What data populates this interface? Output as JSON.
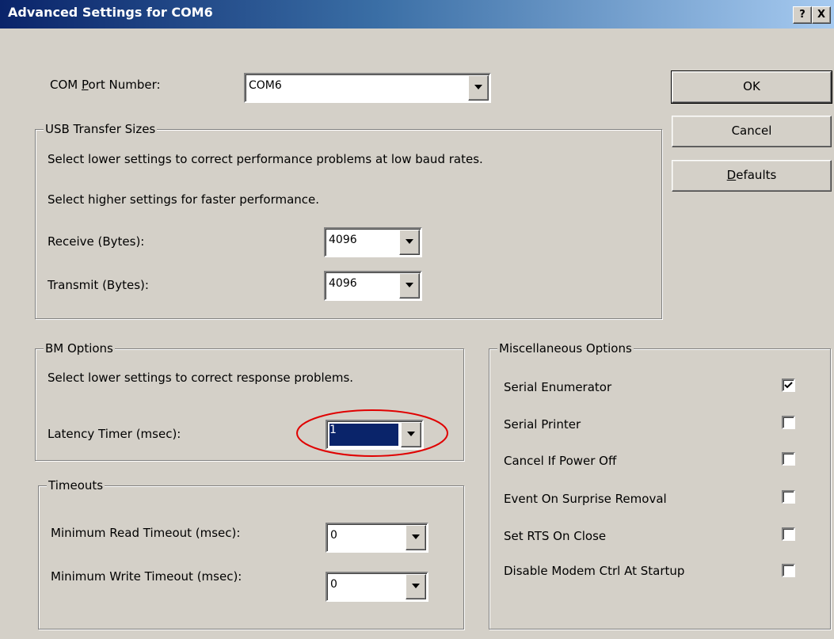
{
  "window": {
    "title": "Advanced Settings for COM6",
    "help_label": "?",
    "close_label": "X"
  },
  "com_port": {
    "label_pre": "COM ",
    "label_accel": "P",
    "label_post": "ort Number:",
    "value": "COM6"
  },
  "buttons": {
    "ok": "OK",
    "cancel": "Cancel",
    "defaults_accel": "D",
    "defaults_rest": "efaults"
  },
  "usb": {
    "title": "USB Transfer Sizes",
    "hint_low": "Select lower settings to correct performance problems at low baud rates.",
    "hint_high": "Select higher settings for faster performance.",
    "receive_label": "Receive (Bytes):",
    "receive_value": "4096",
    "transmit_label": "Transmit (Bytes):",
    "transmit_value": "4096"
  },
  "bm": {
    "title": "BM Options",
    "hint": "Select lower settings to correct response problems.",
    "latency_label": "Latency Timer (msec):",
    "latency_value": "1"
  },
  "timeouts": {
    "title": "Timeouts",
    "read_label": "Minimum Read Timeout (msec):",
    "read_value": "0",
    "write_label": "Minimum Write Timeout (msec):",
    "write_value": "0"
  },
  "misc": {
    "title": "Miscellaneous Options",
    "options": [
      {
        "label": "Serial Enumerator",
        "checked": true
      },
      {
        "label": "Serial Printer",
        "checked": false
      },
      {
        "label": "Cancel If Power Off",
        "checked": false
      },
      {
        "label": "Event On Surprise Removal",
        "checked": false
      },
      {
        "label": "Set RTS On Close",
        "checked": false
      },
      {
        "label": "Disable Modem Ctrl At Startup",
        "checked": false
      }
    ]
  },
  "colors": {
    "titlebar_start": "#0a246a",
    "titlebar_end": "#a6caf0",
    "dialog_face": "#d4d0c8",
    "highlight": "#0a246a",
    "annotation_ellipse": "#e00000"
  }
}
